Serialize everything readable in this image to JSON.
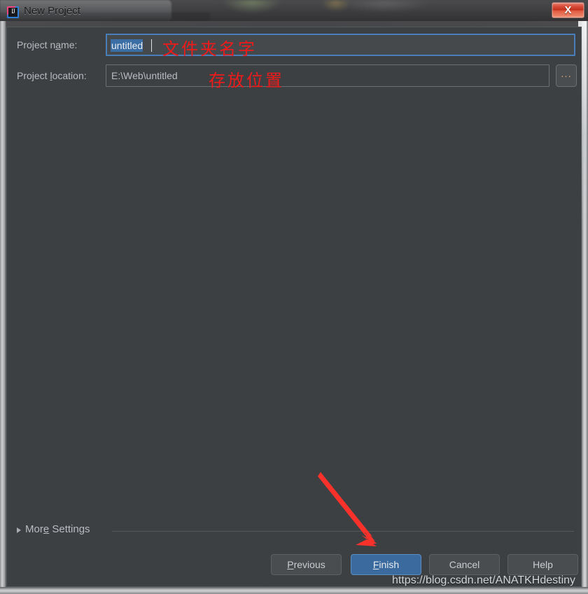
{
  "window": {
    "title": "New Project",
    "app_icon": "intellij-idea-icon",
    "close_label": "X"
  },
  "form": {
    "name_label_pre": "Project n",
    "name_label_mnemonic": "a",
    "name_label_post": "me:",
    "name_value": "untitled",
    "location_label_pre": "Project ",
    "location_label_mnemonic": "l",
    "location_label_post": "ocation:",
    "location_value": "E:\\Web\\untitled",
    "browse_label": "..."
  },
  "annotations": {
    "name_note": "文件夹名字",
    "location_note": "存放位置",
    "arrow_color": "#f01a1a"
  },
  "more_settings": {
    "label_pre": "Mor",
    "label_mnemonic": "e",
    "label_post": " Settings"
  },
  "buttons": {
    "previous_mnemonic": "P",
    "previous_rest": "revious",
    "finish_mnemonic": "F",
    "finish_rest": "inish",
    "cancel": "Cancel",
    "help": "Help"
  },
  "watermark": {
    "text": "https://blog.csdn.net/ANATKHdestiny"
  },
  "colors": {
    "dialog_bg": "#3c4043",
    "accent_blue": "#3b6a9e",
    "focus_border": "#4a7eb8",
    "annotation_red": "#f01a1a",
    "close_red": "#c22f1b"
  }
}
